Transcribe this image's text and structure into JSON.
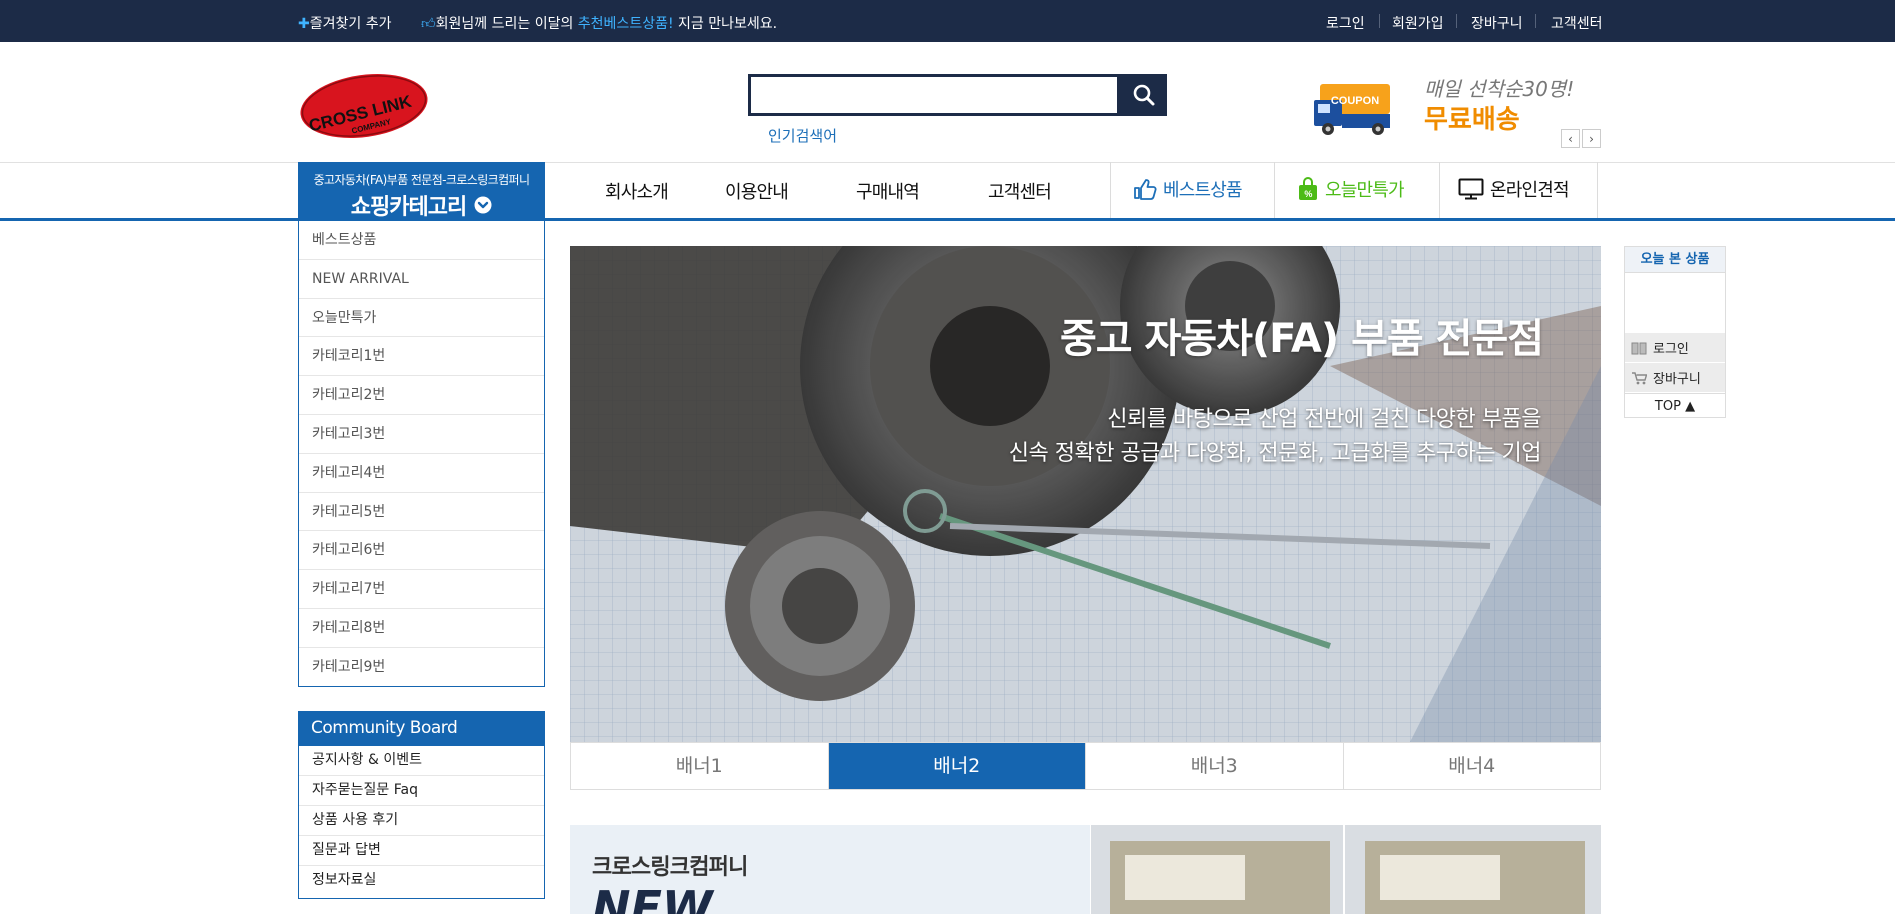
{
  "topbar": {
    "bookmark": "즐겨찾기 추가",
    "notice_prefix": "회원님께 드리는 이달의 ",
    "notice_highlight": "추천베스트상품!",
    "notice_suffix": " 지금 만나보세요.",
    "links": [
      "로그인",
      "회원가입",
      "장바구니",
      "고객센터"
    ]
  },
  "header": {
    "logo_text": "CROSS LINK",
    "logo_sub": "COMPANY",
    "search_placeholder": "",
    "popular_label": "인기검색어",
    "coupon_badge": "COUPON",
    "coupon_line1": "매일 선착순30명!",
    "coupon_line2": "무료배송",
    "arrow_prev": "‹",
    "arrow_next": "›"
  },
  "nav": {
    "category_sub": "중고자동차(FA)부품 전문점-크로스링크컴퍼니",
    "category_main": "쇼핑카테고리",
    "items": [
      "회사소개",
      "이용안내",
      "구매내역",
      "고객센터"
    ],
    "special": [
      "베스트상품",
      "오늘만특가",
      "온라인견적"
    ]
  },
  "categories": [
    "베스트상품",
    "NEW ARRIVAL",
    "오늘만특가",
    "카테코리1번",
    "카테고리2번",
    "카테고리3번",
    "카테고리4번",
    "카테고리5번",
    "카테고리6번",
    "카테고리7번",
    "카테고리8번",
    "카테고리9번"
  ],
  "community": {
    "title": "Community Board",
    "items": [
      "공지사항 & 이벤트",
      "자주묻는질문 Faq",
      "상품 사용 후기",
      "질문과 답변",
      "정보자료실"
    ]
  },
  "banner": {
    "title": "중고 자동차(FA) 부품 전문점",
    "line1": "신뢰를 바탕으로 산업 전반에 걸친 다양한 부품을",
    "line2": "신속 정확한 공급과 다양화, 전문화, 고급화를 추구하는 기업",
    "tabs": [
      "배너1",
      "배너2",
      "배너3",
      "배너4"
    ],
    "active_tab": 1
  },
  "promo": {
    "company": "크로스링크컴퍼니",
    "new": "NEW"
  },
  "quick": {
    "title": "오늘 본 상품",
    "login": "로그인",
    "cart": "장바구니",
    "top": "TOP ▲"
  },
  "colors": {
    "topbar": "#1c2b47",
    "accent": "#1565b0",
    "highlight": "#3fb3ff",
    "best": "#1d6fb8",
    "deal": "#4cbb17"
  }
}
